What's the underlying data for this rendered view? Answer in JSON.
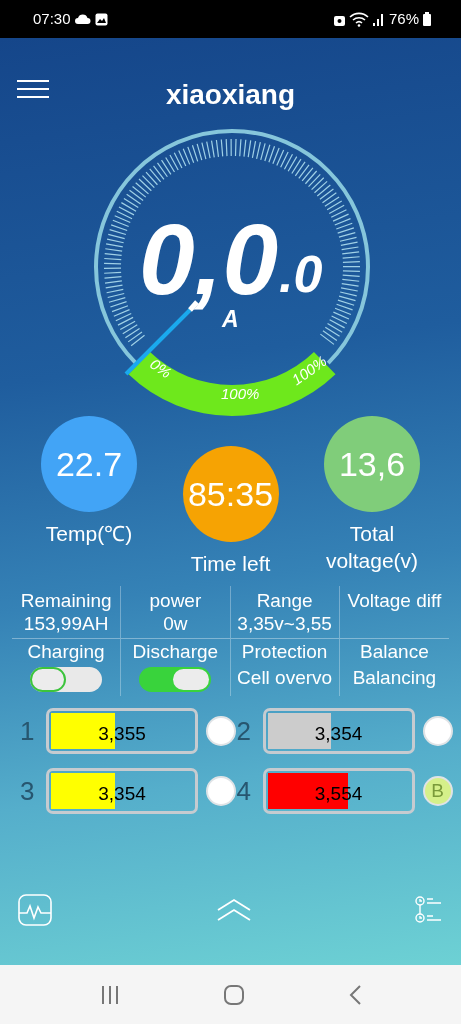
{
  "status_bar": {
    "time": "07:30",
    "battery": "76%"
  },
  "app_bar": {
    "title": "xiaoxiang"
  },
  "gauge": {
    "value": "0,0",
    "decimal": ".0",
    "unit": "A",
    "labels": [
      "0%",
      "100%",
      "100%"
    ]
  },
  "stats": [
    {
      "value": "22.7",
      "label": "Temp(℃)",
      "color": "#42a4f6"
    },
    {
      "value": "85:35",
      "label": "Time left",
      "color": "#f6a303"
    },
    {
      "value": "13,6",
      "label": "Total voltage(v)",
      "color": "#80cd7a"
    }
  ],
  "info": [
    {
      "label": "Remaining",
      "value": "153,99AH"
    },
    {
      "label": "power",
      "value": "0w"
    },
    {
      "label": "Range",
      "value": "3,35v~3,55"
    },
    {
      "label": "Voltage diff"
    }
  ],
  "controls": [
    {
      "kind": "switch",
      "label": "Charging",
      "on": false
    },
    {
      "kind": "switch",
      "label": "Discharge",
      "on": true
    },
    {
      "kind": "text",
      "label": "Protection",
      "value": "Cell overvo"
    },
    {
      "kind": "text",
      "label": "Balance",
      "value": "Balancing"
    }
  ],
  "cells": [
    {
      "number": "1",
      "reading": "3,355",
      "level": 0.45,
      "color": "#ffff00",
      "balancing": false
    },
    {
      "number": "2",
      "reading": "3,354",
      "level": 0.45,
      "color": "#cccccc",
      "balancing": false
    },
    {
      "number": "3",
      "reading": "3,354",
      "level": 0.45,
      "color": "#ffff00",
      "balancing": false
    },
    {
      "number": "4",
      "reading": "3,554",
      "level": 0.57,
      "color": "#ff0000",
      "balancing": true,
      "badge": "B"
    }
  ]
}
